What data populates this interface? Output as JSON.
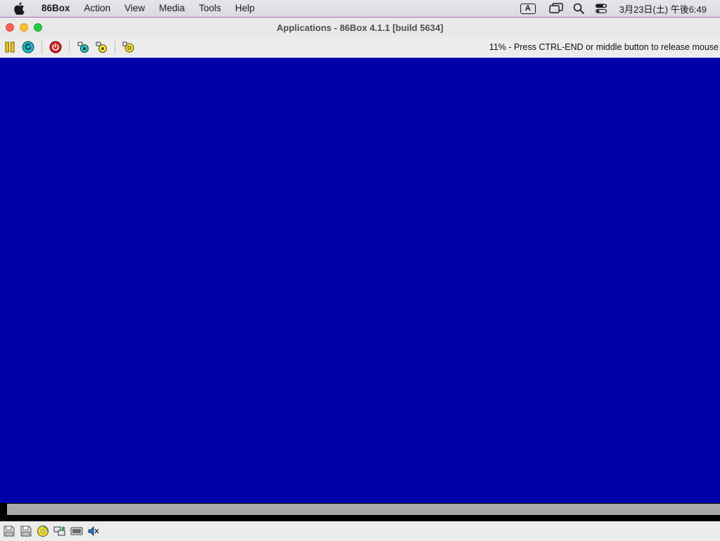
{
  "menubar": {
    "app_name": "86Box",
    "items": [
      "Action",
      "View",
      "Media",
      "Tools",
      "Help"
    ],
    "input_indicator": "A",
    "clock": "3月23日(土) 午後6:49",
    "status_icons": [
      "screen-mirroring-icon",
      "spotlight-search-icon",
      "control-center-icon"
    ]
  },
  "window": {
    "title": "Applications - 86Box 4.1.1 [build 5634]",
    "toolbar_icons": [
      "pause-icon",
      "ctrl-alt-del-icon",
      "power-icon",
      "settings-icon",
      "settings-alt-icon",
      "hardware-icon"
    ],
    "status_message": "11% - Press CTRL-END or middle button to release mouse"
  },
  "statusbar": {
    "icons": [
      "floppy-1-icon",
      "floppy-2-icon",
      "cdrom-icon",
      "network-icon",
      "keyboard-icon",
      "sound-icon"
    ]
  },
  "colors": {
    "emulator_screen": "#0000aa",
    "dos_bar": "#aaaaaa"
  }
}
